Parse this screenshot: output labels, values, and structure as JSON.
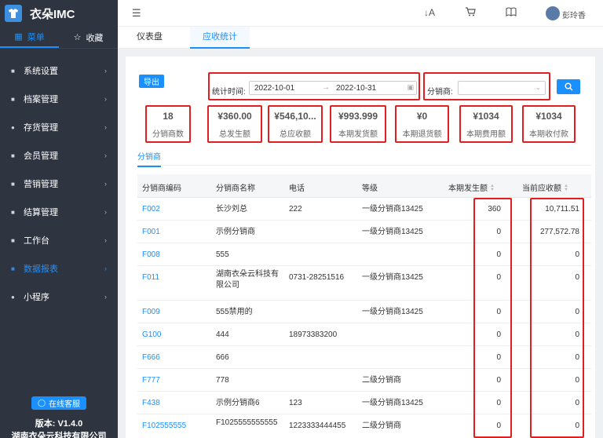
{
  "app": {
    "title": "衣朵IMC",
    "version": "版本: V1.4.0",
    "company": "湖南衣朵云科技有限公司"
  },
  "sidebar": {
    "tabs": [
      {
        "label": "菜单",
        "icon": "grid-icon"
      },
      {
        "label": "收藏",
        "icon": "star-icon"
      }
    ],
    "items": [
      {
        "label": "系统设置"
      },
      {
        "label": "档案管理"
      },
      {
        "label": "存货管理"
      },
      {
        "label": "会员管理"
      },
      {
        "label": "营销管理"
      },
      {
        "label": "结算管理"
      },
      {
        "label": "工作台"
      },
      {
        "label": "数据报表"
      },
      {
        "label": "小程序"
      }
    ],
    "active_item": "数据报表",
    "service_label": "在线客服"
  },
  "topbar": {
    "username": "彭玲香"
  },
  "page_tabs": [
    {
      "label": "仪表盘"
    },
    {
      "label": "应收统计"
    }
  ],
  "toolbar": {
    "export_label": "导出"
  },
  "filter": {
    "date_label": "统计时间:",
    "start_date": "2022-10-01",
    "end_date": "2022-10-31",
    "distributor_label": "分销商:",
    "distributor_value": ""
  },
  "stats": [
    {
      "value": "18",
      "label": "分销商数"
    },
    {
      "value": "¥360.00",
      "label": "总发生额"
    },
    {
      "value": "¥546,10...",
      "label": "总应收额"
    },
    {
      "value": "¥993.999",
      "label": "本期发货额"
    },
    {
      "value": "¥0",
      "label": "本期退货额"
    },
    {
      "value": "¥1034",
      "label": "本期费用额"
    },
    {
      "value": "¥1034",
      "label": "本期收付款"
    }
  ],
  "section_tab": "分销商",
  "table": {
    "columns": [
      "分销商编码",
      "分销商名称",
      "电话",
      "等级",
      "本期发生额",
      "当前应收额"
    ],
    "rows": [
      {
        "code": "F002",
        "name": "长沙刘总",
        "phone": "222",
        "level": "一级分销商13425",
        "amount": "360",
        "receivable": "10,711.51"
      },
      {
        "code": "F001",
        "name": "示例分销商",
        "phone": "",
        "level": "一级分销商13425",
        "amount": "0",
        "receivable": "277,572.78"
      },
      {
        "code": "F008",
        "name": "555",
        "phone": "",
        "level": "",
        "amount": "0",
        "receivable": "0"
      },
      {
        "code": "F011",
        "name": "湖南衣朵云科技有限公司",
        "phone": "0731-28251516",
        "level": "一级分销商13425",
        "amount": "0",
        "receivable": "0"
      },
      {
        "code": "F009",
        "name": "555禁用的",
        "phone": "",
        "level": "一级分销商13425",
        "amount": "0",
        "receivable": "0"
      },
      {
        "code": "G100",
        "name": "444",
        "phone": "18973383200",
        "level": "",
        "amount": "0",
        "receivable": "0"
      },
      {
        "code": "F666",
        "name": "666",
        "phone": "",
        "level": "",
        "amount": "0",
        "receivable": "0"
      },
      {
        "code": "F777",
        "name": "778",
        "phone": "",
        "level": "二级分销商",
        "amount": "0",
        "receivable": "0"
      },
      {
        "code": "F438",
        "name": "示例分销商6",
        "phone": "123",
        "level": "一级分销商13425",
        "amount": "0",
        "receivable": "0"
      },
      {
        "code": "F102555555",
        "name": "F1025555555555",
        "phone": "1223333444455",
        "level": "二级分销商",
        "amount": "0",
        "receivable": "0"
      }
    ]
  }
}
